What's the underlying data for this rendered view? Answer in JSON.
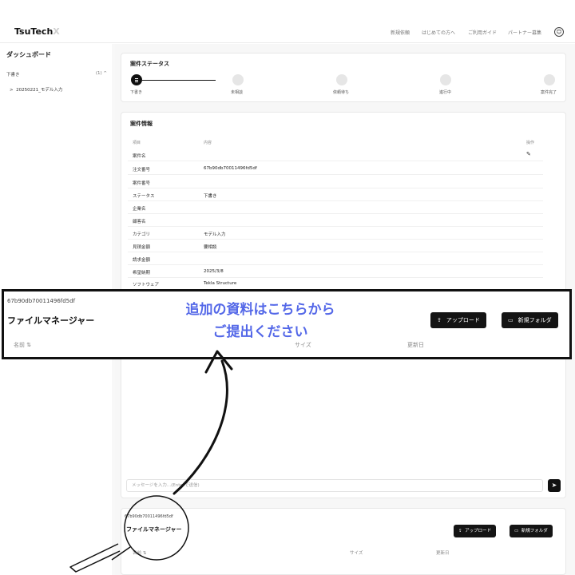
{
  "header": {
    "logo_text": "TsuTech",
    "logo_mark": "X",
    "nav": [
      "新規依頼",
      "はじめての方へ",
      "ご利用ガイド",
      "パートナー募集"
    ],
    "user_icon": "user-circle-icon"
  },
  "sidebar": {
    "title": "ダッシュボード",
    "group_label": "下書き",
    "group_count": "(1) ^",
    "item_label": "20250221_モデル入力",
    "item_chevron": ">"
  },
  "status_card": {
    "title": "案件ステータス",
    "steps": [
      "下書き",
      "未相談",
      "依頼待ち",
      "進行中",
      "案件完了"
    ]
  },
  "info_card": {
    "title": "案件情報",
    "col_item": "項目",
    "col_content": "内容",
    "col_action": "操作",
    "rows": [
      {
        "label": "案件名",
        "value": ""
      },
      {
        "label": "注文番号",
        "value": "67b90db70011496fd5df"
      },
      {
        "label": "案件番号",
        "value": ""
      },
      {
        "label": "ステータス",
        "value": "下書き"
      },
      {
        "label": "企業名",
        "value": ""
      },
      {
        "label": "顧客名",
        "value": ""
      },
      {
        "label": "カテゴリ",
        "value": "モデル入力"
      },
      {
        "label": "見積金額",
        "value": "要相談"
      },
      {
        "label": "請求金額",
        "value": ""
      },
      {
        "label": "希望納期",
        "value": "2025/3/8"
      },
      {
        "label": "ソフトウェア",
        "value": "Tekla Structure"
      }
    ]
  },
  "file_manager_highlight": {
    "id": "67b90db70011496fd5df",
    "title": "ファイルマネージャー",
    "col_name": "名前 ⇅",
    "col_size": "サイズ",
    "col_updated": "更新日",
    "upload_label": "アップロード",
    "new_folder_label": "新規フォルダ"
  },
  "annotation": {
    "line1": "追加の資料はこちらから",
    "line2": "ご提出ください"
  },
  "message_bar": {
    "placeholder": "メッセージを入力...(Enterで送信)"
  },
  "file_manager_bottom": {
    "id": "67b90db70011496fd5df",
    "title": "ファイルマネージャー",
    "col_name": "名前 ⇅",
    "col_size": "サイズ",
    "col_updated": "更新日",
    "upload_label": "アップロード",
    "new_folder_label": "新規フォルダ"
  },
  "colors": {
    "annotation": "#5468e8",
    "button_bg": "#141414",
    "accent_dark": "#111111"
  }
}
